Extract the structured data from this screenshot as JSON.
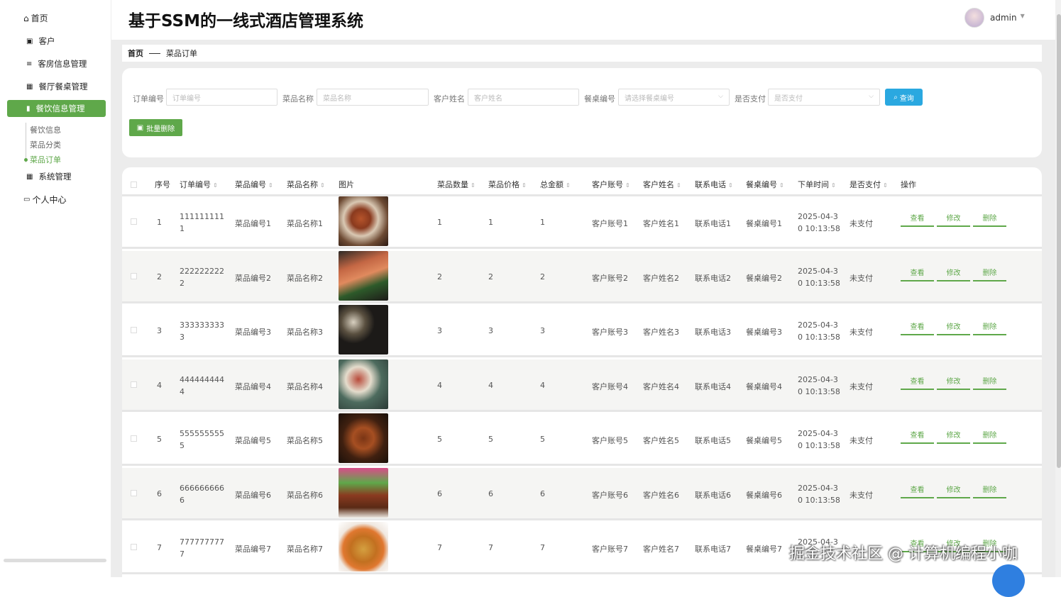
{
  "sidebar": {
    "home": "首页",
    "items": [
      {
        "label": "客户",
        "icon": "user-icon"
      },
      {
        "label": "客房信息管理",
        "icon": "list-icon"
      },
      {
        "label": "餐厅餐桌管理",
        "icon": "grid-icon"
      },
      {
        "label": "餐饮信息管理",
        "icon": "bar-chart-icon",
        "active": true
      },
      {
        "label": "系统管理",
        "icon": "grid-icon"
      }
    ],
    "submenu": [
      "餐饮信息",
      "菜品分类",
      "菜品订单"
    ],
    "personal": "个人中心"
  },
  "header": {
    "title": "基于SSM的一线式酒店管理系统",
    "user": "admin"
  },
  "breadcrumb": {
    "home": "首页",
    "current": "菜品订单"
  },
  "filters": {
    "order_no": {
      "label": "订单编号",
      "placeholder": "订单编号"
    },
    "dish_name": {
      "label": "菜品名称",
      "placeholder": "菜品名称"
    },
    "customer_name": {
      "label": "客户姓名",
      "placeholder": "客户姓名"
    },
    "table_no": {
      "label": "餐桌编号",
      "placeholder": "请选择餐桌编号"
    },
    "paid": {
      "label": "是否支付",
      "placeholder": "是否支付"
    },
    "search": "查询",
    "batch_delete": "批量删除"
  },
  "table": {
    "headers": [
      "序号",
      "订单编号",
      "菜品编号",
      "菜品名称",
      "图片",
      "菜品数量",
      "菜品价格",
      "总金额",
      "客户账号",
      "客户姓名",
      "联系电话",
      "餐桌编号",
      "下单时间",
      "是否支付",
      "操作"
    ],
    "actions": {
      "view": "查看",
      "edit": "修改",
      "delete": "删除"
    },
    "rows": [
      {
        "idx": "1",
        "order1": "111111111",
        "order2": "1",
        "dish_no": "菜品编号1",
        "dish_name": "菜品名称1",
        "qty": "1",
        "price": "1",
        "total": "1",
        "account": "客户账号1",
        "cust": "客户姓名1",
        "phone": "联系电话1",
        "table": "餐桌编号1",
        "time1": "2025-04-3",
        "time2": "0 10:13:58",
        "paid": "未支付"
      },
      {
        "idx": "2",
        "order1": "222222222",
        "order2": "2",
        "dish_no": "菜品编号2",
        "dish_name": "菜品名称2",
        "qty": "2",
        "price": "2",
        "total": "2",
        "account": "客户账号2",
        "cust": "客户姓名2",
        "phone": "联系电话2",
        "table": "餐桌编号2",
        "time1": "2025-04-3",
        "time2": "0 10:13:58",
        "paid": "未支付"
      },
      {
        "idx": "3",
        "order1": "333333333",
        "order2": "3",
        "dish_no": "菜品编号3",
        "dish_name": "菜品名称3",
        "qty": "3",
        "price": "3",
        "total": "3",
        "account": "客户账号3",
        "cust": "客户姓名3",
        "phone": "联系电话3",
        "table": "餐桌编号3",
        "time1": "2025-04-3",
        "time2": "0 10:13:58",
        "paid": "未支付"
      },
      {
        "idx": "4",
        "order1": "444444444",
        "order2": "4",
        "dish_no": "菜品编号4",
        "dish_name": "菜品名称4",
        "qty": "4",
        "price": "4",
        "total": "4",
        "account": "客户账号4",
        "cust": "客户姓名4",
        "phone": "联系电话4",
        "table": "餐桌编号4",
        "time1": "2025-04-3",
        "time2": "0 10:13:58",
        "paid": "未支付"
      },
      {
        "idx": "5",
        "order1": "555555555",
        "order2": "5",
        "dish_no": "菜品编号5",
        "dish_name": "菜品名称5",
        "qty": "5",
        "price": "5",
        "total": "5",
        "account": "客户账号5",
        "cust": "客户姓名5",
        "phone": "联系电话5",
        "table": "餐桌编号5",
        "time1": "2025-04-3",
        "time2": "0 10:13:58",
        "paid": "未支付"
      },
      {
        "idx": "6",
        "order1": "666666666",
        "order2": "6",
        "dish_no": "菜品编号6",
        "dish_name": "菜品名称6",
        "qty": "6",
        "price": "6",
        "total": "6",
        "account": "客户账号6",
        "cust": "客户姓名6",
        "phone": "联系电话6",
        "table": "餐桌编号6",
        "time1": "2025-04-3",
        "time2": "0 10:13:58",
        "paid": "未支付"
      },
      {
        "idx": "7",
        "order1": "777777777",
        "order2": "7",
        "dish_no": "菜品编号7",
        "dish_name": "菜品名称7",
        "qty": "7",
        "price": "7",
        "total": "7",
        "account": "客户账号7",
        "cust": "客户姓名7",
        "phone": "联系电话7",
        "table": "餐桌编号7",
        "time1": "2025-04-3",
        "time2": "",
        "paid": ""
      }
    ]
  },
  "watermark": "掘金技术社区 @ 计算机编程小咖",
  "colors": {
    "accent": "#5fa84a",
    "search": "#2aa8e0"
  }
}
